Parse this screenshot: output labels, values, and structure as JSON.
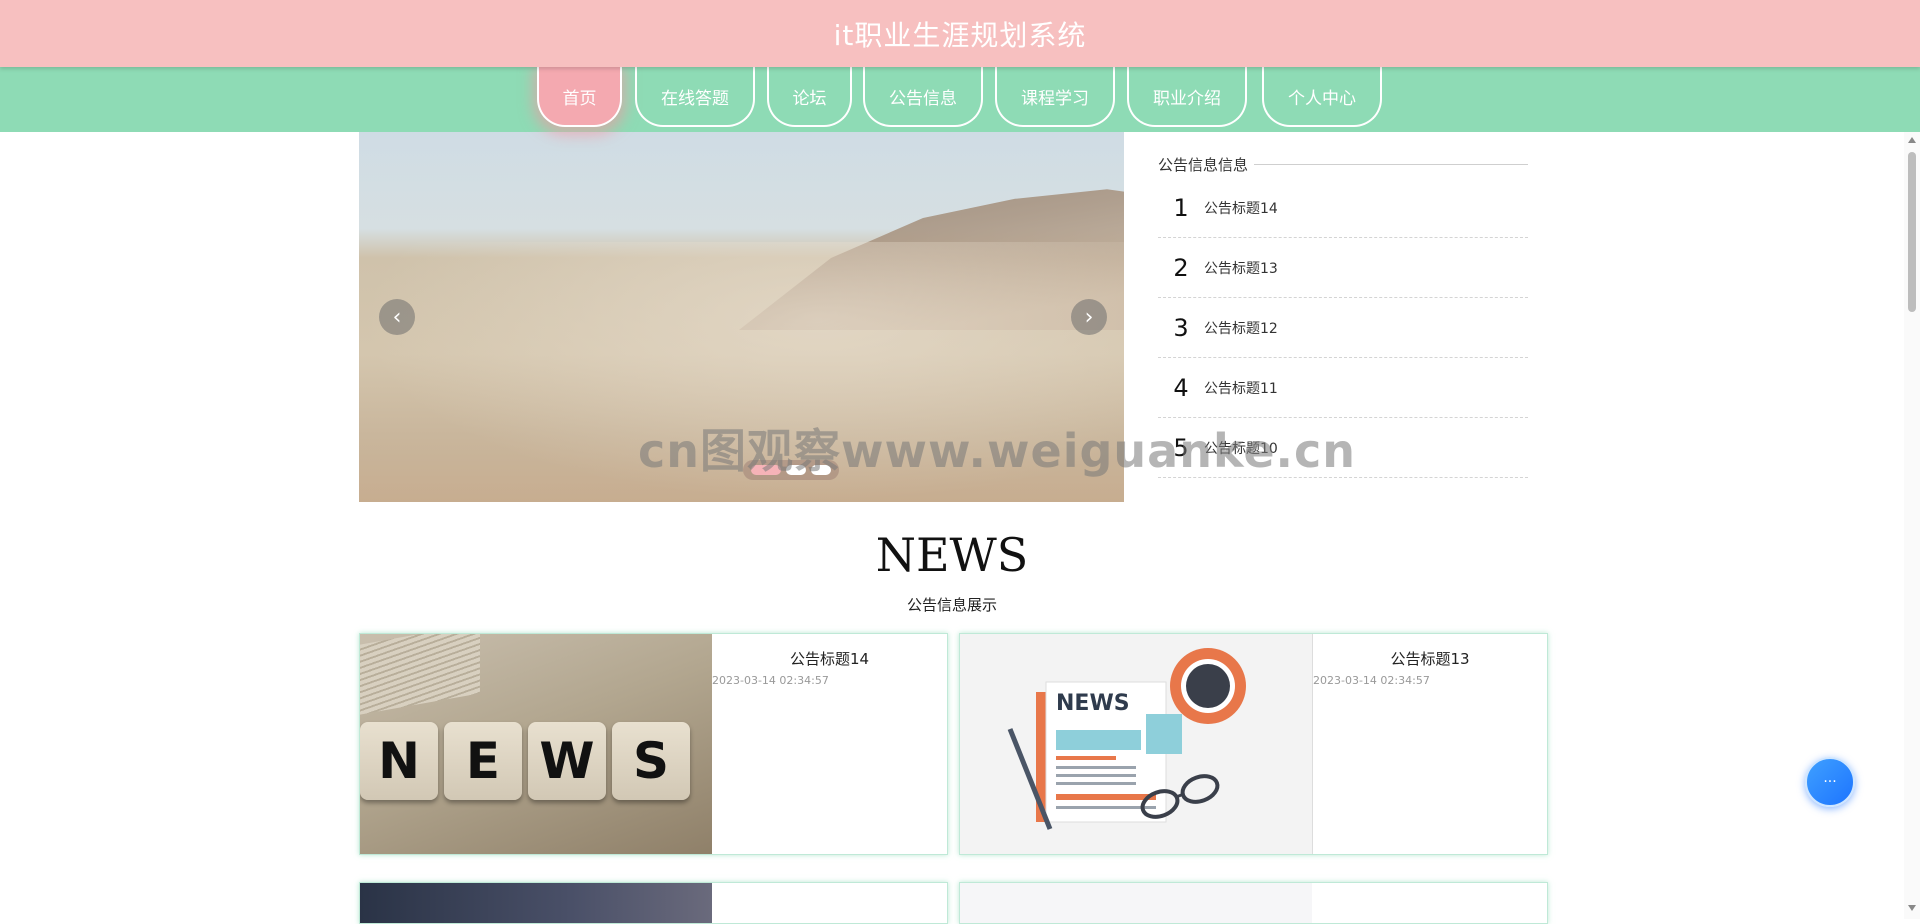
{
  "header": {
    "title": "it职业生涯规划系统"
  },
  "nav": {
    "items": [
      {
        "label": "首页"
      },
      {
        "label": "在线答题"
      },
      {
        "label": "论坛"
      },
      {
        "label": "公告信息"
      },
      {
        "label": "课程学习"
      },
      {
        "label": "职业介绍"
      },
      {
        "label": "个人中心"
      }
    ],
    "active_index": 0
  },
  "carousel": {
    "prev_icon": "chevron-left-icon",
    "next_icon": "chevron-right-icon",
    "slide_count": 3,
    "active_slide": 1
  },
  "notice": {
    "title": "公告信息信息",
    "items": [
      {
        "num": "1",
        "text": "公告标题14"
      },
      {
        "num": "2",
        "text": "公告标题13"
      },
      {
        "num": "3",
        "text": "公告标题12"
      },
      {
        "num": "4",
        "text": "公告标题11"
      },
      {
        "num": "5",
        "text": "公告标题10"
      }
    ]
  },
  "watermark": "cn图观察www.weiguanke.cn",
  "news": {
    "heading": "NEWS",
    "subtitle": "公告信息展示",
    "cards": [
      {
        "title": "公告标题14",
        "date": "2023-03-14 02:34:57",
        "image_letters": [
          "N",
          "E",
          "W",
          "S"
        ]
      },
      {
        "title": "公告标题13",
        "date": "2023-03-14 02:34:57",
        "image_text": "NEWS"
      }
    ]
  },
  "float_button": {
    "icon": "chat-icon",
    "label": "···"
  },
  "colors": {
    "header_bg": "#f7c0c0",
    "nav_bg": "#8edbb5",
    "active_nav": "#f4a9b0",
    "card_border": "#bfe9d7",
    "float_btn": "#2a86ff"
  }
}
